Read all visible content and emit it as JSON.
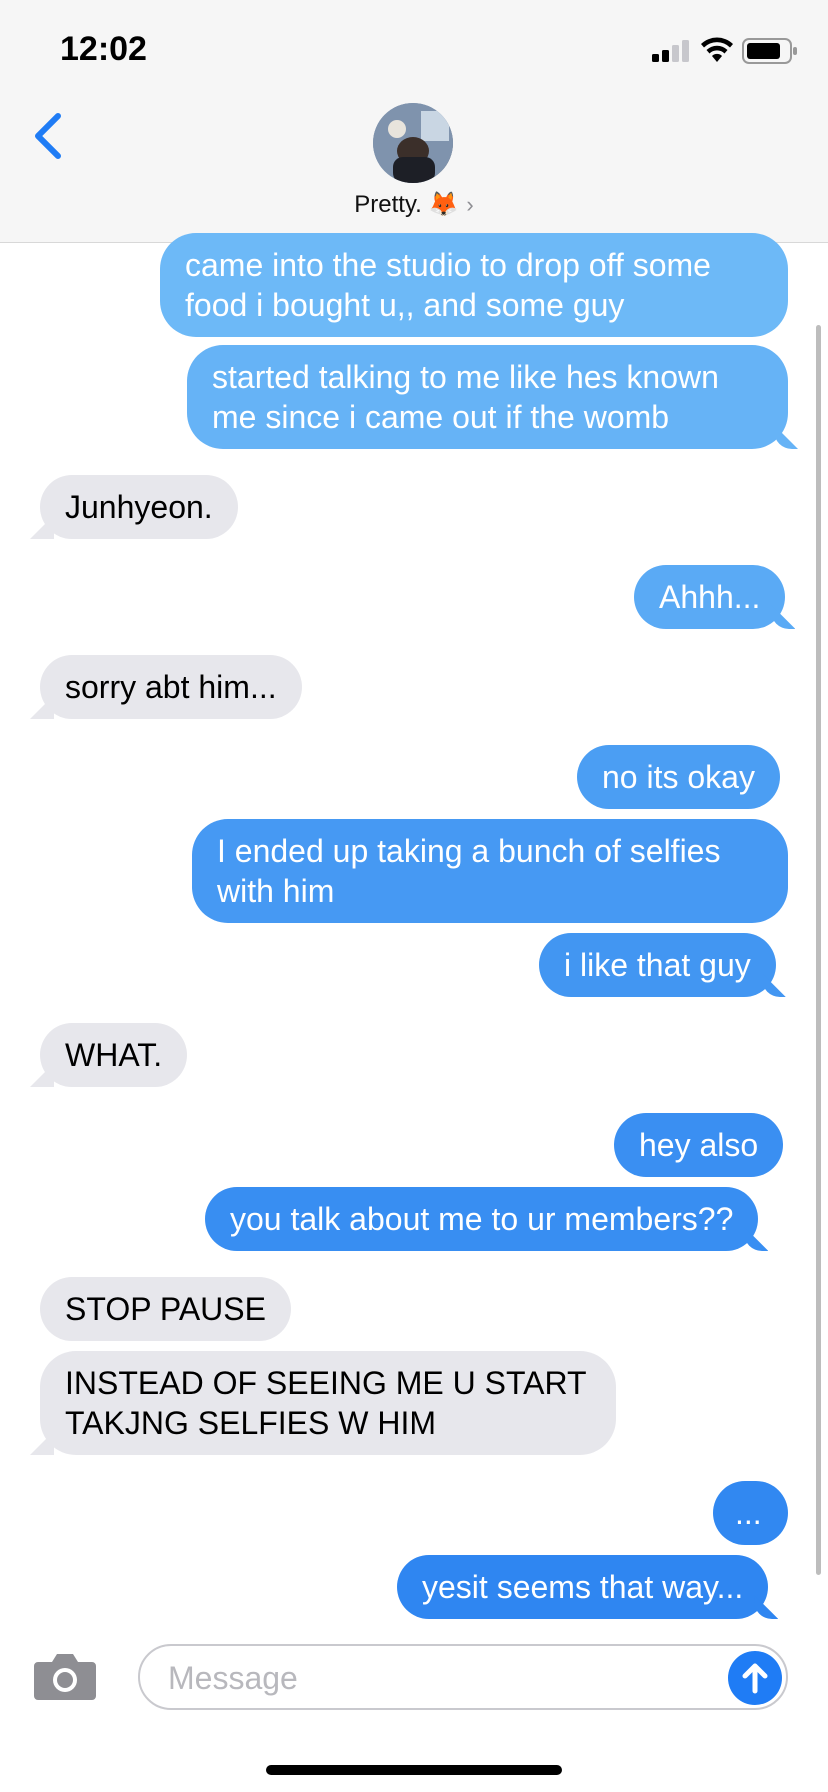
{
  "status_bar": {
    "time": "12:02"
  },
  "header": {
    "contact_name": "Pretty. 🦊",
    "chevron": "›"
  },
  "messages": [
    {
      "from": "me",
      "text": "came into the studio to drop off some food i bought u,, and some guy"
    },
    {
      "from": "me",
      "text": "started talking to me like hes known me since i came out if the womb"
    },
    {
      "from": "them",
      "text": "Junhyeon."
    },
    {
      "from": "me",
      "text": "Ahhh..."
    },
    {
      "from": "them",
      "text": "sorry abt him..."
    },
    {
      "from": "me",
      "text": "no its okay"
    },
    {
      "from": "me",
      "text": "I ended up taking a bunch of selfies with him"
    },
    {
      "from": "me",
      "text": "i like that guy"
    },
    {
      "from": "them",
      "text": "WHAT."
    },
    {
      "from": "me",
      "text": "hey also"
    },
    {
      "from": "me",
      "text": "you talk about me to ur members??"
    },
    {
      "from": "them",
      "text": "STOP PAUSE"
    },
    {
      "from": "them",
      "text": "INSTEAD OF SEEING ME U START TAKJNG SELFIES W HIM"
    },
    {
      "from": "me",
      "text": "..."
    },
    {
      "from": "me",
      "text": "yesit seems that way..."
    }
  ],
  "composer": {
    "placeholder": "Message"
  },
  "icons": {
    "back": "chevron-left-icon",
    "camera": "camera-icon",
    "send": "arrow-up-icon",
    "signal": "cellular-signal-icon",
    "wifi": "wifi-icon",
    "battery": "battery-icon"
  },
  "colors": {
    "outgoing_top": "#6cb8f7",
    "outgoing_bottom": "#2f80f0",
    "incoming": "#e7e7ec",
    "accent": "#1f7cf5"
  }
}
